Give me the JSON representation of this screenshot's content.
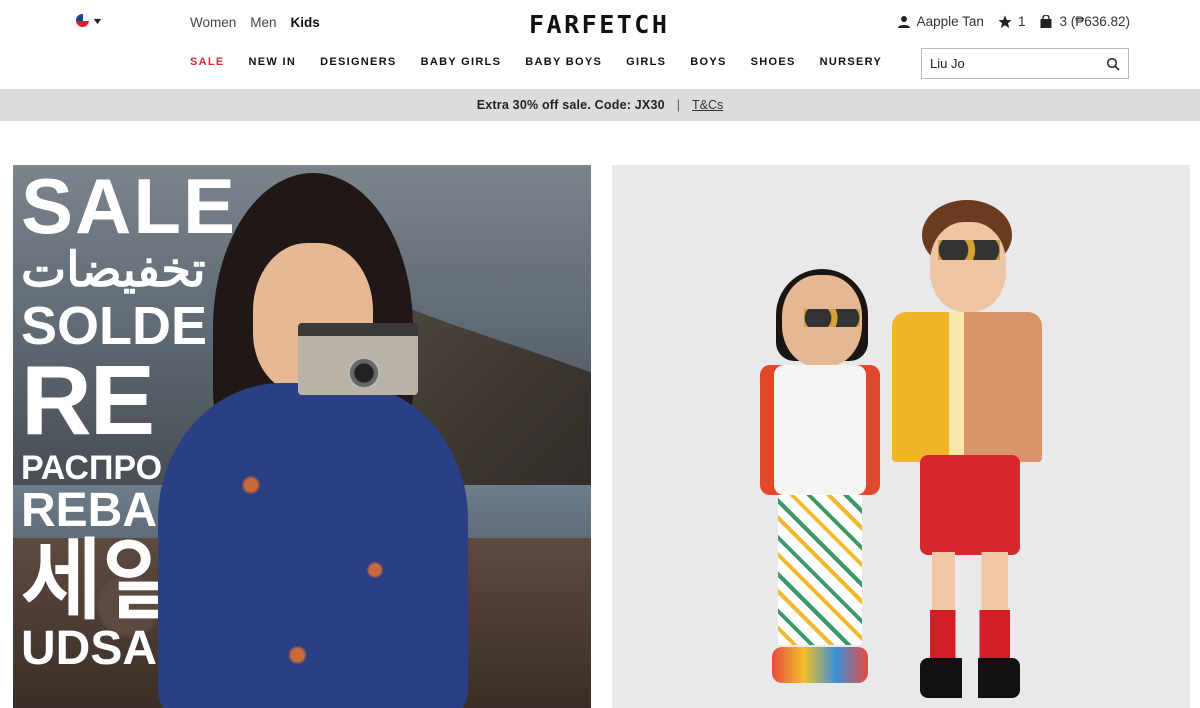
{
  "header": {
    "locale": {
      "flag": "flag-icon",
      "chevron": "chevron-down-icon"
    },
    "gender_nav": [
      {
        "label": "Women",
        "active": false
      },
      {
        "label": "Men",
        "active": false
      },
      {
        "label": "Kids",
        "active": true
      }
    ],
    "logo": "FARFETCH",
    "account": {
      "user_name": "Aapple Tan",
      "wishlist_count": "1",
      "bag_label": "3 (₱636.82)"
    },
    "search": {
      "value": "Liu Jo",
      "placeholder": ""
    }
  },
  "category_nav": [
    {
      "label": "SALE",
      "highlight": true
    },
    {
      "label": "NEW IN",
      "highlight": false
    },
    {
      "label": "DESIGNERS",
      "highlight": false
    },
    {
      "label": "BABY GIRLS",
      "highlight": false
    },
    {
      "label": "BABY BOYS",
      "highlight": false
    },
    {
      "label": "GIRLS",
      "highlight": false
    },
    {
      "label": "BOYS",
      "highlight": false
    },
    {
      "label": "SHOES",
      "highlight": false
    },
    {
      "label": "NURSERY",
      "highlight": false
    }
  ],
  "promo": {
    "text": "Extra 30% off sale. Code: JX30",
    "separator": "|",
    "link": "T&Cs"
  },
  "hero_left": {
    "lines": [
      "SALE",
      "تخفيضات",
      "SOLDE",
      "RE",
      "РАСПРО",
      "REBA",
      "세일",
      "UDSA"
    ]
  },
  "colors": {
    "sale_red": "#d1303b",
    "promo_bg": "#dcdcdc",
    "text": "#222222"
  }
}
